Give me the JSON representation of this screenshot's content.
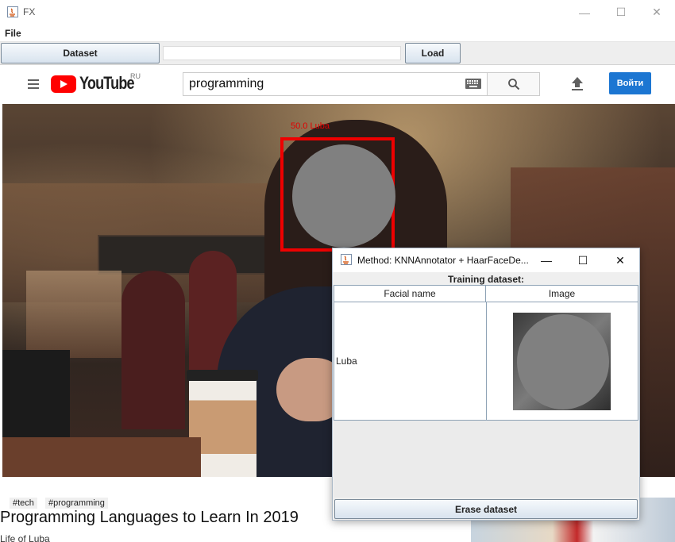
{
  "window": {
    "title": "FX",
    "minimize_symbol": "—",
    "maximize_symbol": "☐",
    "close_symbol": "✕"
  },
  "menu": {
    "file_label": "File"
  },
  "toolbar": {
    "dataset_label": "Dataset",
    "dataset_path_value": "",
    "load_label": "Load"
  },
  "youtube": {
    "wordmark": "YouTube",
    "region": "RU",
    "search_value": "programming",
    "signin_label": "Войти",
    "icons": [
      "menu-icon",
      "youtube-logo-icon",
      "keyboard-icon",
      "search-icon",
      "upload-icon"
    ],
    "brand_color": "#ff0000",
    "accent_color": "#1c76d2"
  },
  "video": {
    "detection_label": "50.0  Luba",
    "box_color": "#ee0000",
    "tags": [
      "#tech",
      "#programming"
    ],
    "title": "Programming Languages to Learn In 2019",
    "channel": "Life of Luba"
  },
  "dialog": {
    "title": "Method: KNNAnnotator + HaarFaceDe...",
    "minimize_symbol": "—",
    "maximize_symbol": "☐",
    "close_symbol": "✕",
    "training_label": "Training dataset:",
    "columns": [
      "Facial name",
      "Image"
    ],
    "rows": [
      {
        "name": "Luba",
        "image": "face-thumbnail"
      }
    ],
    "erase_label": "Erase dataset"
  }
}
